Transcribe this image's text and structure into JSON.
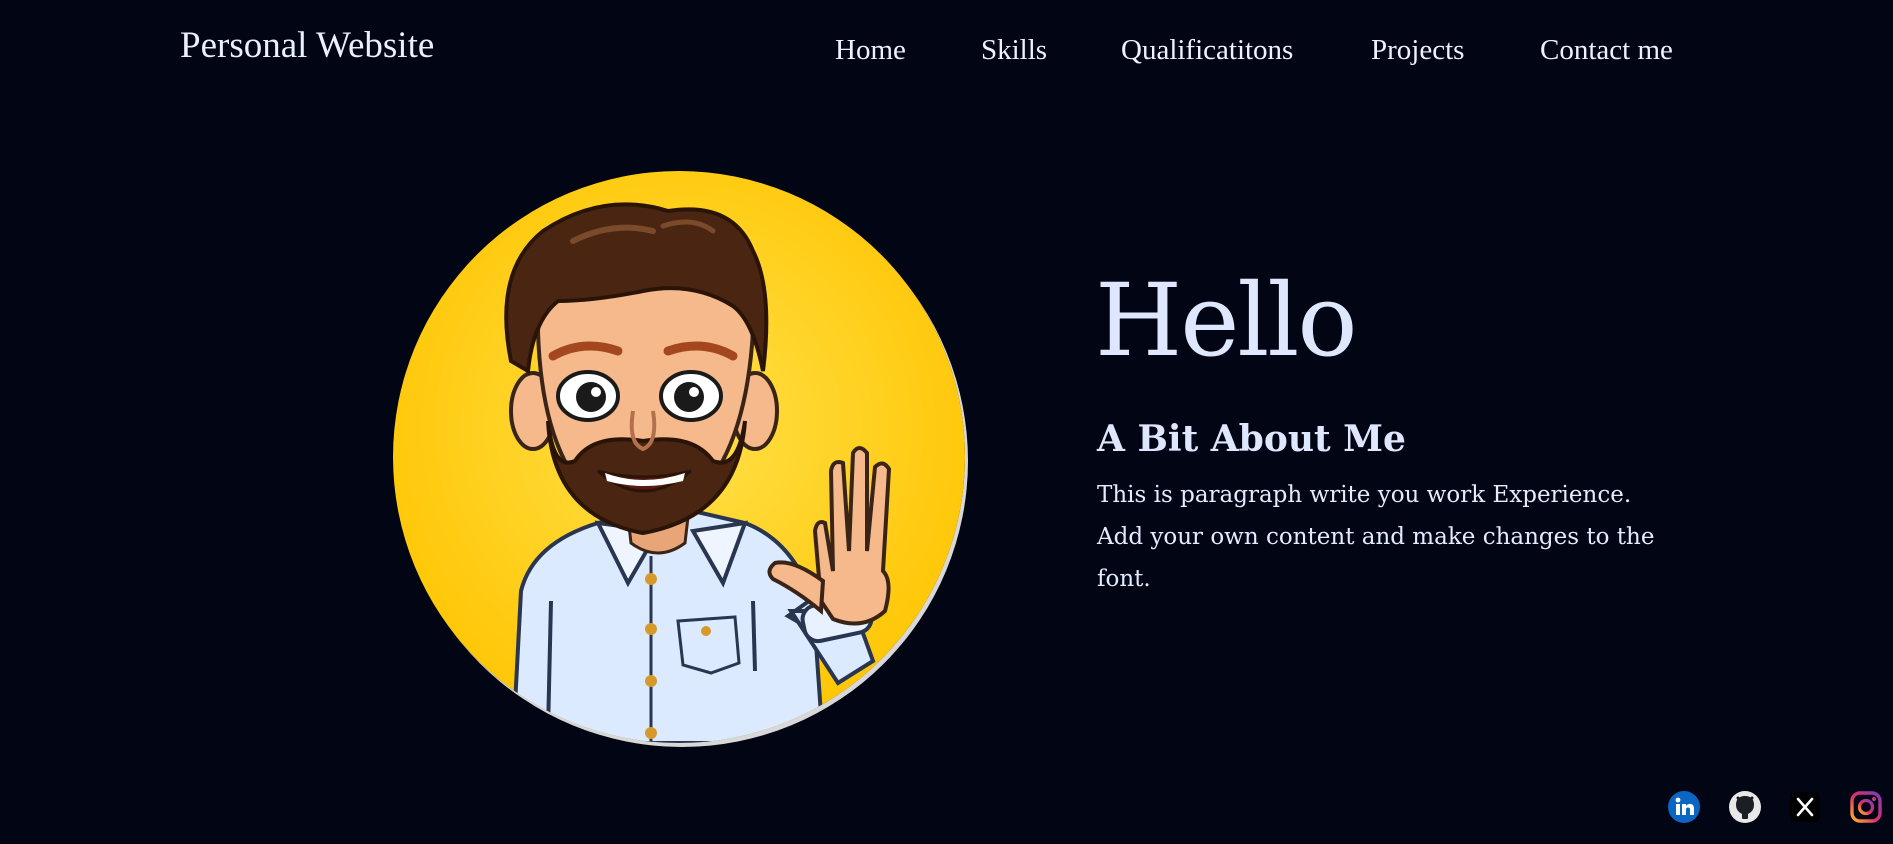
{
  "header": {
    "site_title": "Personal Website",
    "nav": [
      {
        "label": "Home"
      },
      {
        "label": "Skills"
      },
      {
        "label": "Qualificatitons"
      },
      {
        "label": "Projects"
      },
      {
        "label": "Contact me"
      }
    ]
  },
  "hero": {
    "avatar_icon": "waving-cartoon-man-avatar",
    "greeting": "Hello",
    "about_heading": "A Bit About Me",
    "about_paragraph": "This is paragraph write you work Experience. Add your own content and make changes to the font."
  },
  "social": [
    {
      "icon": "linkedin-icon",
      "color": "#0a66c2"
    },
    {
      "icon": "github-icon",
      "color": "#e8e8e8"
    },
    {
      "icon": "x-icon",
      "color": "#000000"
    },
    {
      "icon": "instagram-icon",
      "color": "#e1306c"
    }
  ],
  "colors": {
    "background": "#020513",
    "text": "#dfe7ff",
    "avatar_background": "#ffd000"
  }
}
